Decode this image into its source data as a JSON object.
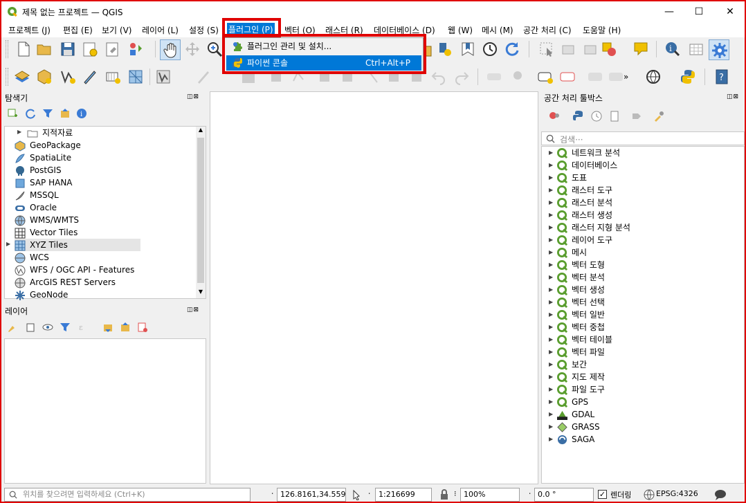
{
  "window": {
    "title": "제목 없는 프로젝트 — QGIS",
    "minimize": "—",
    "maximize": "☐",
    "close": "✕"
  },
  "menu": [
    {
      "label": "프로젝트 (J)"
    },
    {
      "label": "편집 (E)"
    },
    {
      "label": "보기 (V)"
    },
    {
      "label": "레이어 (L)"
    },
    {
      "label": "설정 (S)"
    },
    {
      "label": "플러그인 (P)",
      "active": true
    },
    {
      "label": "벡터 (O)"
    },
    {
      "label": "래스터 (R)"
    },
    {
      "label": "데이터베이스 (D)"
    },
    {
      "label": "웹 (W)"
    },
    {
      "label": "메시 (M)"
    },
    {
      "label": "공간 처리 (C)"
    },
    {
      "label": "도움말 (H)"
    }
  ],
  "plugin_menu": {
    "items": [
      {
        "label": "플러그인 관리 및 설치...",
        "shortcut": "",
        "icon": "puzzle-icon"
      },
      {
        "label": "파이썬 콘솔",
        "shortcut": "Ctrl+Alt+P",
        "icon": "python-icon",
        "selected": true
      }
    ]
  },
  "browser": {
    "title": "탐색기",
    "items": [
      {
        "label": "지적자료",
        "icon": "folder-icon",
        "expandable": true
      },
      {
        "label": "GeoPackage",
        "icon": "geopackage-icon"
      },
      {
        "label": "SpatiaLite",
        "icon": "spatialite-icon"
      },
      {
        "label": "PostGIS",
        "icon": "postgis-icon"
      },
      {
        "label": "SAP HANA",
        "icon": "hana-icon"
      },
      {
        "label": "MSSQL",
        "icon": "mssql-icon"
      },
      {
        "label": "Oracle",
        "icon": "oracle-icon"
      },
      {
        "label": "WMS/WMTS",
        "icon": "wms-icon"
      },
      {
        "label": "Vector Tiles",
        "icon": "vector-tiles-icon"
      },
      {
        "label": "XYZ Tiles",
        "icon": "xyz-tiles-icon",
        "expandable": true,
        "selected": true
      },
      {
        "label": "WCS",
        "icon": "wcs-icon"
      },
      {
        "label": "WFS / OGC API - Features",
        "icon": "wfs-icon"
      },
      {
        "label": "ArcGIS REST Servers",
        "icon": "arcgis-icon"
      },
      {
        "label": "GeoNode",
        "icon": "geonode-icon"
      }
    ]
  },
  "layers": {
    "title": "레이어"
  },
  "processing": {
    "title": "공간 처리 툴박스",
    "search_placeholder": "검색···",
    "items": [
      {
        "label": "네트워크 분석",
        "icon": "qgis-icon"
      },
      {
        "label": "데이터베이스",
        "icon": "qgis-icon"
      },
      {
        "label": "도표",
        "icon": "qgis-icon"
      },
      {
        "label": "래스터 도구",
        "icon": "qgis-icon"
      },
      {
        "label": "래스터 분석",
        "icon": "qgis-icon"
      },
      {
        "label": "래스터 생성",
        "icon": "qgis-icon"
      },
      {
        "label": "래스터 지형 분석",
        "icon": "qgis-icon"
      },
      {
        "label": "레이어 도구",
        "icon": "qgis-icon"
      },
      {
        "label": "메시",
        "icon": "qgis-icon"
      },
      {
        "label": "벡터 도형",
        "icon": "qgis-icon"
      },
      {
        "label": "벡터 분석",
        "icon": "qgis-icon"
      },
      {
        "label": "벡터 생성",
        "icon": "qgis-icon"
      },
      {
        "label": "벡터 선택",
        "icon": "qgis-icon"
      },
      {
        "label": "벡터 일반",
        "icon": "qgis-icon"
      },
      {
        "label": "벡터 중첩",
        "icon": "qgis-icon"
      },
      {
        "label": "벡터 테이블",
        "icon": "qgis-icon"
      },
      {
        "label": "벡터 파일",
        "icon": "qgis-icon"
      },
      {
        "label": "보간",
        "icon": "qgis-icon"
      },
      {
        "label": "지도 제작",
        "icon": "qgis-icon"
      },
      {
        "label": "파일 도구",
        "icon": "qgis-icon"
      },
      {
        "label": "GPS",
        "icon": "qgis-icon"
      },
      {
        "label": "GDAL",
        "icon": "gdal-icon"
      },
      {
        "label": "GRASS",
        "icon": "grass-icon"
      },
      {
        "label": "SAGA",
        "icon": "saga-icon"
      }
    ]
  },
  "statusbar": {
    "locate_placeholder": "위치를 찾으려면 입력하세요 (Ctrl+K)",
    "coordinate": "126.8161,34.5594",
    "scale": "1:216699",
    "magnifier": "100%",
    "rotation": "0.0 °",
    "render_label": "렌더링",
    "crs": "EPSG:4326"
  },
  "colors": {
    "highlight": "#e00000",
    "selection": "#0078d7",
    "qgis_green": "#5a9e2f"
  }
}
